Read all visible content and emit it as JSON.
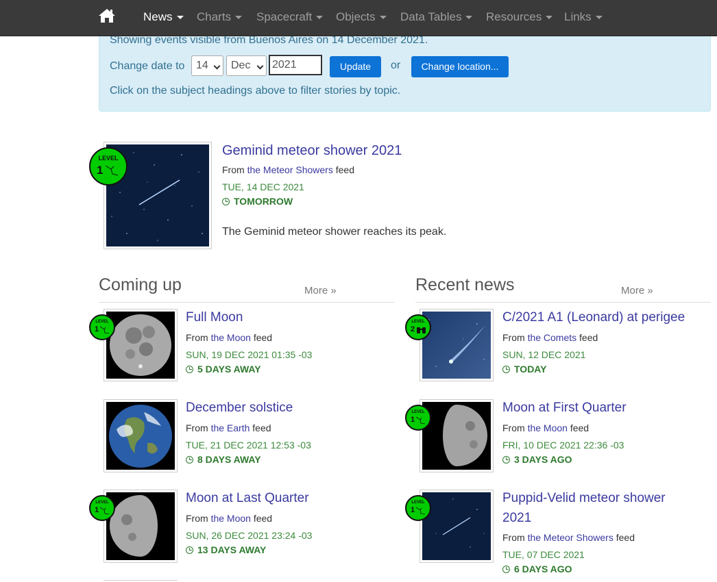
{
  "nav": {
    "items": [
      {
        "label": "News",
        "active": true
      },
      {
        "label": "Charts"
      },
      {
        "label": "Spacecraft"
      },
      {
        "label": "Objects"
      },
      {
        "label": "Data Tables"
      },
      {
        "label": "Resources"
      },
      {
        "label": "Links"
      }
    ]
  },
  "info": {
    "showing": "Showing events visible from Buenos Aires on 14 December 2021.",
    "change_label": "Change date to",
    "day": "14",
    "month": "Dec",
    "year": "2021",
    "update_label": "Update",
    "or_label": "or",
    "change_location_label": "Change location...",
    "hint": "Click on the subject headings above to filter stories by topic."
  },
  "featured": {
    "title": "Geminid meteor shower 2021",
    "from_prefix": "From ",
    "feed": "the Meteor Showers",
    "from_suffix": " feed",
    "date": "TUE, 14 DEC 2021",
    "relative": "TOMORROW",
    "description": "The Geminid meteor shower reaches its peak.",
    "level": "1"
  },
  "coming_up": {
    "heading": "Coming up",
    "more": "More »",
    "items": [
      {
        "title": "Full Moon",
        "feed": "the Moon",
        "date": "SUN, 19 DEC 2021 01:35 -03",
        "relative": "5 DAYS AWAY",
        "level": "1"
      },
      {
        "title": "December solstice",
        "feed": "the Earth",
        "date": "TUE, 21 DEC 2021 12:53 -03",
        "relative": "8 DAYS AWAY"
      },
      {
        "title": "Moon at Last Quarter",
        "feed": "the Moon",
        "date": "SUN, 26 DEC 2021 23:24 -03",
        "relative": "13 DAYS AWAY",
        "level": "1"
      }
    ]
  },
  "recent": {
    "heading": "Recent news",
    "more": "More »",
    "items": [
      {
        "title": "C/2021 A1 (Leonard) at perigee",
        "feed": "the Comets",
        "date": "SUN, 12 DEC 2021",
        "relative": "TODAY",
        "level": "2"
      },
      {
        "title": "Moon at First Quarter",
        "feed": "the Moon",
        "date": "FRI, 10 DEC 2021 22:36 -03",
        "relative": "3 DAYS AGO",
        "level": "1"
      },
      {
        "title_line1": "Puppid-Velid meteor shower",
        "title_line2": "2021",
        "feed": "the Meteor Showers",
        "date": "TUE, 07 DEC 2021",
        "relative": "6 DAYS AGO",
        "level": "1"
      }
    ]
  },
  "common": {
    "from_prefix": "From ",
    "from_suffix": " feed",
    "level_word": "LEVEL"
  }
}
